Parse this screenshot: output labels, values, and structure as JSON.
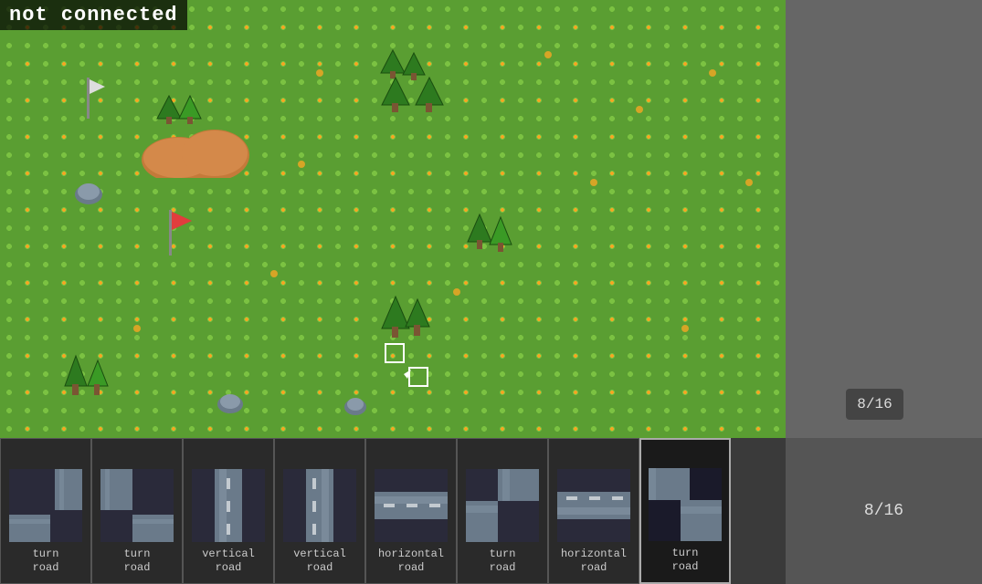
{
  "status": {
    "connection": "not connected"
  },
  "counter": {
    "current": 8,
    "total": 16,
    "label": "8/16"
  },
  "tiles": [
    {
      "id": 0,
      "label_line1": "turn",
      "label_line2": "road",
      "type": "turn-road-1"
    },
    {
      "id": 1,
      "label_line1": "turn",
      "label_line2": "road",
      "type": "turn-road-2"
    },
    {
      "id": 2,
      "label_line1": "vertical",
      "label_line2": "road",
      "type": "vertical-road-1"
    },
    {
      "id": 3,
      "label_line1": "vertical",
      "label_line2": "road",
      "type": "vertical-road-2"
    },
    {
      "id": 4,
      "label_line1": "horizontal",
      "label_line2": "road",
      "type": "horizontal-road-1"
    },
    {
      "id": 5,
      "label_line1": "turn",
      "label_line2": "road",
      "type": "turn-road-3"
    },
    {
      "id": 6,
      "label_line1": "horizontal",
      "label_line2": "road",
      "type": "horizontal-road-2"
    },
    {
      "id": 7,
      "label_line1": "turn",
      "label_line2": "road",
      "type": "turn-road-4"
    }
  ]
}
